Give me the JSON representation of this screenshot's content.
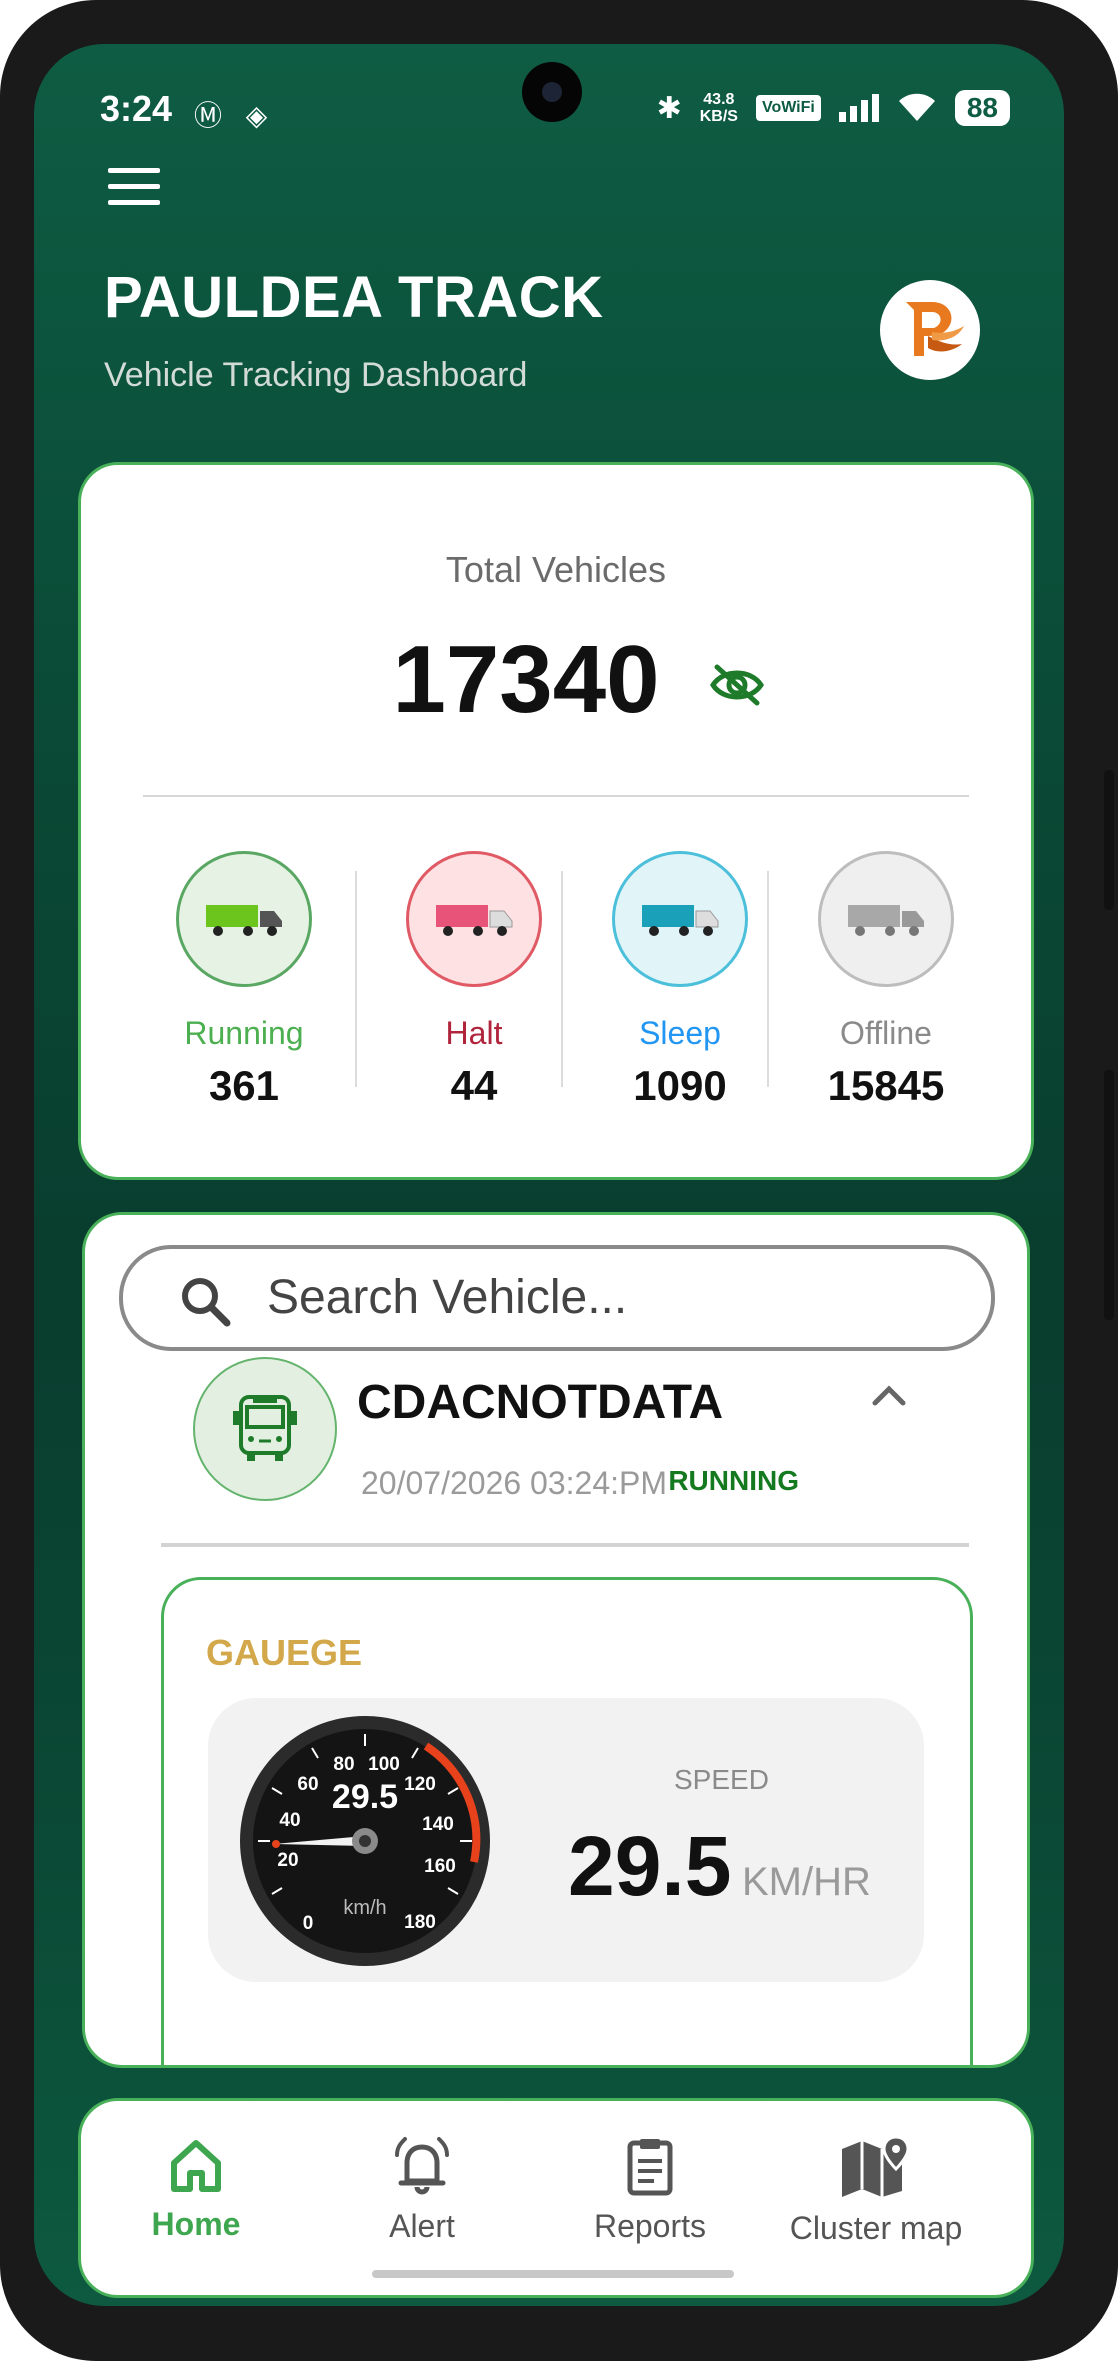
{
  "status_bar": {
    "time": "3:24",
    "net_speed_top": "43.8",
    "net_speed_bottom": "KB/S",
    "vowifi": "VoWiFi",
    "battery": "88"
  },
  "header": {
    "title": "PAULDEA TRACK",
    "subtitle": "Vehicle Tracking Dashboard"
  },
  "summary": {
    "label": "Total Vehicles",
    "total": "17340",
    "stats": [
      {
        "name": "Running",
        "value": "361",
        "color": "#4caf50",
        "bg": "#e6f3e4",
        "ring": "#5aa763",
        "truck": "#6cc51d"
      },
      {
        "name": "Halt",
        "value": "44",
        "color": "#b0243c",
        "bg": "#fde1e3",
        "ring": "#e05a65",
        "truck": "#e8537a"
      },
      {
        "name": "Sleep",
        "value": "1090",
        "color": "#2196f3",
        "bg": "#e1f4f8",
        "ring": "#4cc0da",
        "truck": "#1aa0b8"
      },
      {
        "name": "Offline",
        "value": "15845",
        "color": "#8a8a8a",
        "bg": "#efefef",
        "ring": "#bdbdbd",
        "truck": "#a8a8a8"
      }
    ]
  },
  "search": {
    "placeholder": "Search Vehicle..."
  },
  "vehicle": {
    "name": "CDACNOTDATA",
    "timestamp": "20/07/2026 03:24:PM",
    "status": "RUNNING",
    "gauge_title": "GAUEGE",
    "gauge_readout": "29.5",
    "gauge_unit": "km/h",
    "speed_label": "SPEED",
    "speed_value": "29.5",
    "speed_unit": "KM/HR",
    "gauge_ticks": [
      "0",
      "20",
      "40",
      "60",
      "80",
      "100",
      "120",
      "140",
      "160",
      "180"
    ]
  },
  "nav": {
    "items": [
      {
        "label": "Home",
        "icon": "home-icon"
      },
      {
        "label": "Alert",
        "icon": "bell-icon"
      },
      {
        "label": "Reports",
        "icon": "clipboard-icon"
      },
      {
        "label": "Cluster map",
        "icon": "map-icon"
      }
    ]
  },
  "colors": {
    "brand_green": "#0e5c43",
    "accent_green": "#49b05a",
    "gauge_title": "#d2a84a"
  }
}
